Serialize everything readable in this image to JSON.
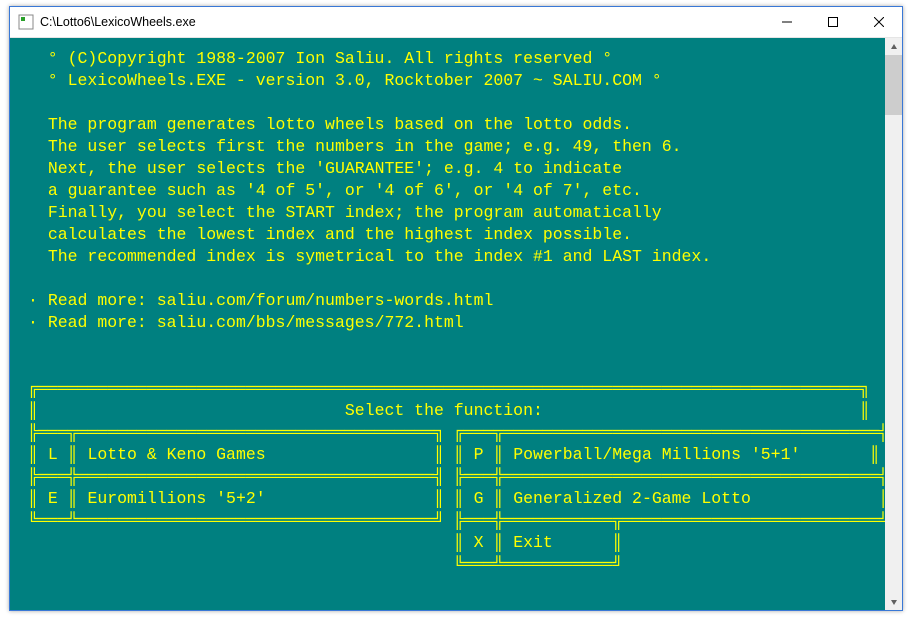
{
  "window": {
    "title": "C:\\Lotto6\\LexicoWheels.exe"
  },
  "header": {
    "copyright": "(C)Copyright 1988-2007 Ion Saliu. All rights reserved",
    "versionLine": "LexicoWheels.EXE - version 3.0, Rocktober 2007 ~ SALIU.COM"
  },
  "description": {
    "l1": "The program generates lotto wheels based on the lotto odds.",
    "l2": "The user selects first the numbers in the game; e.g. 49, then 6.",
    "l3": "Next, the user selects the 'GUARANTEE'; e.g. 4 to indicate",
    "l4": "a guarantee such as '4 of 5', or '4 of 6', or '4 of 7', etc.",
    "l5": "Finally, you select the START index; the program automatically",
    "l6": "calculates the lowest index and the highest index possible.",
    "l7": "The recommended index is symetrical to the index #1 and LAST index."
  },
  "readmore": {
    "r1_label": "Read more: ",
    "r1_url": "saliu.com/forum/numbers-words.html",
    "r2_label": "Read more: ",
    "r2_url": "saliu.com/bbs/messages/772.html"
  },
  "menu": {
    "title": "Select the function:",
    "items": [
      {
        "key": "L",
        "label": "Lotto & Keno Games"
      },
      {
        "key": "P",
        "label": "Powerball/Mega Millions '5+1'"
      },
      {
        "key": "E",
        "label": "Euromillions '5+2'"
      },
      {
        "key": "G",
        "label": "Generalized 2-Game Lotto"
      },
      {
        "key": "X",
        "label": "Exit"
      }
    ]
  },
  "colors": {
    "console_bg": "#008080",
    "console_fg": "#ffff00",
    "window_accent": "#3a78d6"
  }
}
